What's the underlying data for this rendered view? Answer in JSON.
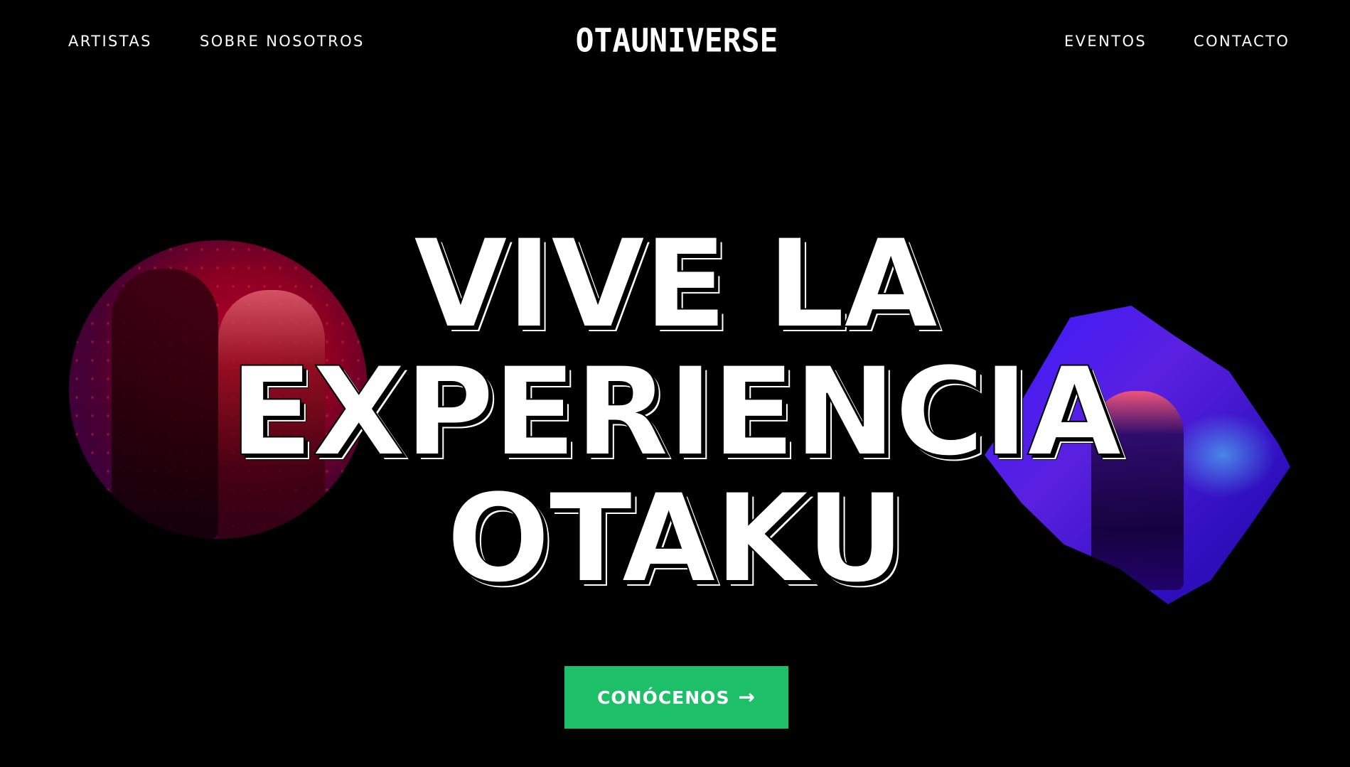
{
  "nav": {
    "left": [
      {
        "label": "ARTISTAS"
      },
      {
        "label": "SOBRE NOSOTROS"
      }
    ],
    "right": [
      {
        "label": "EVENTOS"
      },
      {
        "label": "CONTACTO"
      }
    ]
  },
  "brand": {
    "logo_text": "OTAUNIVERSE"
  },
  "hero": {
    "lines": [
      "VIVE LA",
      "EXPERIENCIA",
      "OTAKU"
    ],
    "cta_label": "CONÓCENOS",
    "cta_icon": "arrow-right-icon"
  },
  "colors": {
    "background": "#000000",
    "cta": "#1dbf68",
    "text": "#ffffff"
  }
}
